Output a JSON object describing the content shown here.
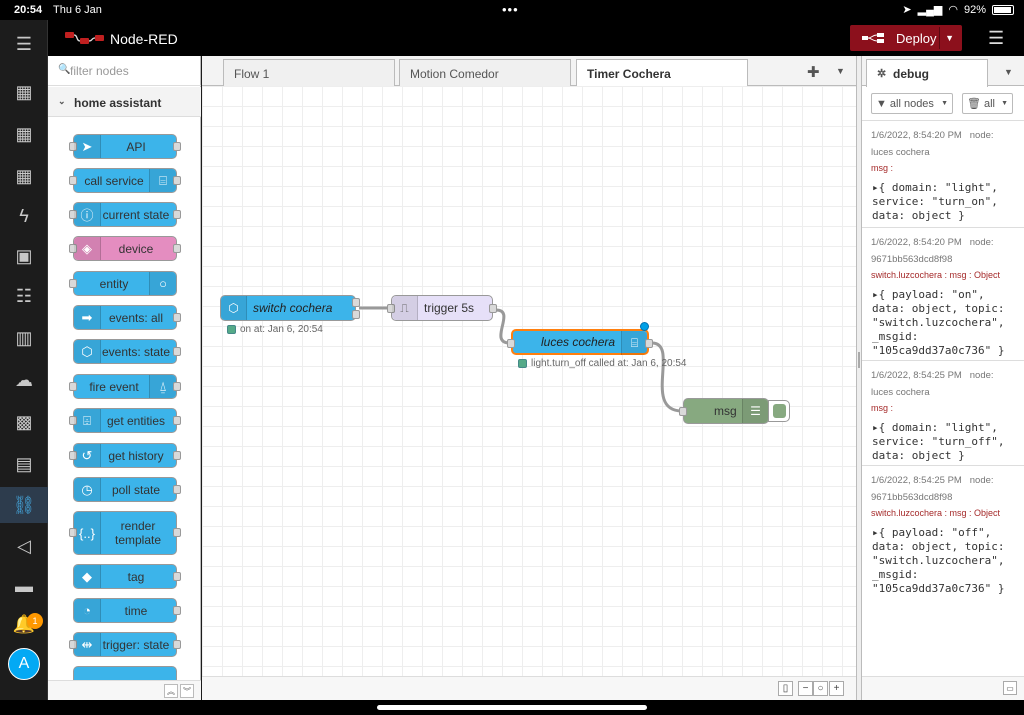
{
  "status_bar": {
    "time": "20:54",
    "date": "Thu 6 Jan",
    "battery": "92%"
  },
  "app": {
    "title": "Node-RED",
    "deploy_label": "Deploy"
  },
  "ha_sidebar": {
    "avatar": "A",
    "notifications": "1"
  },
  "palette": {
    "search_placeholder": "filter nodes",
    "category": "home assistant",
    "nodes": [
      {
        "label": "API",
        "icon": "send-icon"
      },
      {
        "label": "call service",
        "icon": "router-icon"
      },
      {
        "label": "current state",
        "icon": "info-icon"
      },
      {
        "label": "device",
        "icon": "cube-icon"
      },
      {
        "label": "entity",
        "icon": "circle-icon"
      },
      {
        "label": "events: all",
        "icon": "arrow-right-icon"
      },
      {
        "label": "events: state",
        "icon": "hexagon-arrow-icon"
      },
      {
        "label": "fire event",
        "icon": "antenna-icon"
      },
      {
        "label": "get entities",
        "icon": "entities-icon"
      },
      {
        "label": "get history",
        "icon": "history-icon"
      },
      {
        "label": "poll state",
        "icon": "timer-icon"
      },
      {
        "label": "render template",
        "icon": "braces-icon"
      },
      {
        "label": "tag",
        "icon": "tag-icon"
      },
      {
        "label": "time",
        "icon": "clock-icon"
      },
      {
        "label": "trigger: state",
        "icon": "signpost-icon"
      }
    ]
  },
  "tabs": [
    {
      "label": "Flow 1"
    },
    {
      "label": "Motion Comedor"
    },
    {
      "label": "Timer Cochera"
    }
  ],
  "flow": {
    "switch_node": {
      "label": "switch cochera",
      "status": "on at: Jan 6, 20:54"
    },
    "trigger_node": {
      "label": "trigger 5s"
    },
    "service_node": {
      "label": "luces cochera",
      "status": "light.turn_off called at: Jan 6, 20:54"
    },
    "debug_node": {
      "label": "msg"
    }
  },
  "debug": {
    "tab_label": "debug",
    "filter_label": "all nodes",
    "clear_label": "all",
    "messages": [
      {
        "timestamp": "1/6/2022, 8:54:20 PM",
        "node_label": "node:",
        "node": "luces cochera",
        "topic": "msg :",
        "lines": [
          "▸{ domain: \"light\",",
          "service: \"turn_on\",",
          "data: object }"
        ]
      },
      {
        "timestamp": "1/6/2022, 8:54:20 PM",
        "node_label": "node:",
        "node": "9671bb563dcd8f98",
        "topic": "switch.luzcochera : msg : Object",
        "lines": [
          "▸{ payload: \"on\",",
          "data: object, topic:",
          "\"switch.luzcochera\",",
          "_msgid:",
          "\"105ca9dd37a0c736\" }"
        ]
      },
      {
        "timestamp": "1/6/2022, 8:54:25 PM",
        "node_label": "node:",
        "node": "luces cochera",
        "topic": "msg :",
        "lines": [
          "▸{ domain: \"light\",",
          "service: \"turn_off\",",
          "data: object }"
        ]
      },
      {
        "timestamp": "1/6/2022, 8:54:25 PM",
        "node_label": "node:",
        "node": "9671bb563dcd8f98",
        "topic": "switch.luzcochera : msg : Object",
        "lines": [
          "▸{ payload: \"off\",",
          "data: object, topic:",
          "\"switch.luzcochera\",",
          "_msgid:",
          "\"105ca9dd37a0c736\" }"
        ]
      }
    ]
  },
  "colors": {
    "ha_blue": "#3cb4ea",
    "device_pink": "#e48dc0",
    "deploy_red": "#8c101c",
    "debug_green": "#87a980",
    "trigger_lavender": "#e6e0f8"
  }
}
